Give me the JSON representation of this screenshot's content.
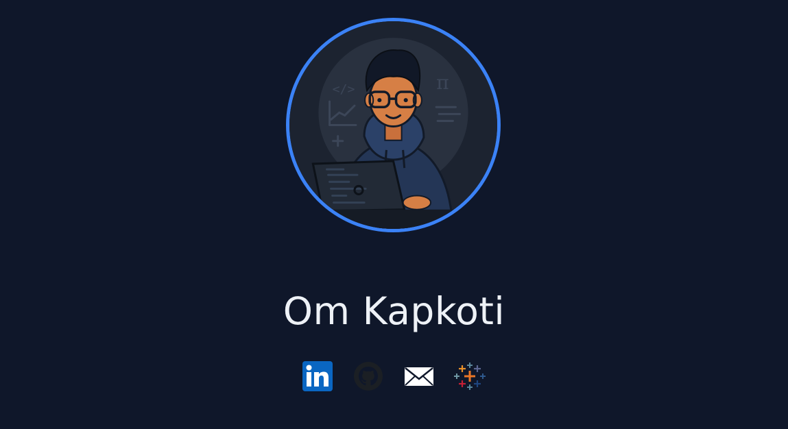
{
  "profile": {
    "name": "Om Kapkoti",
    "avatar_icon": "developer-avatar-illustration",
    "accent_color": "#3b82f6",
    "background_color": "#0f172a"
  },
  "socials": [
    {
      "icon": "linkedin-icon",
      "color": "#0a66c2"
    },
    {
      "icon": "github-icon",
      "color": "#1b1f24"
    },
    {
      "icon": "email-icon",
      "color": "#ffffff"
    },
    {
      "icon": "tableau-icon",
      "color": "#e97627"
    }
  ]
}
